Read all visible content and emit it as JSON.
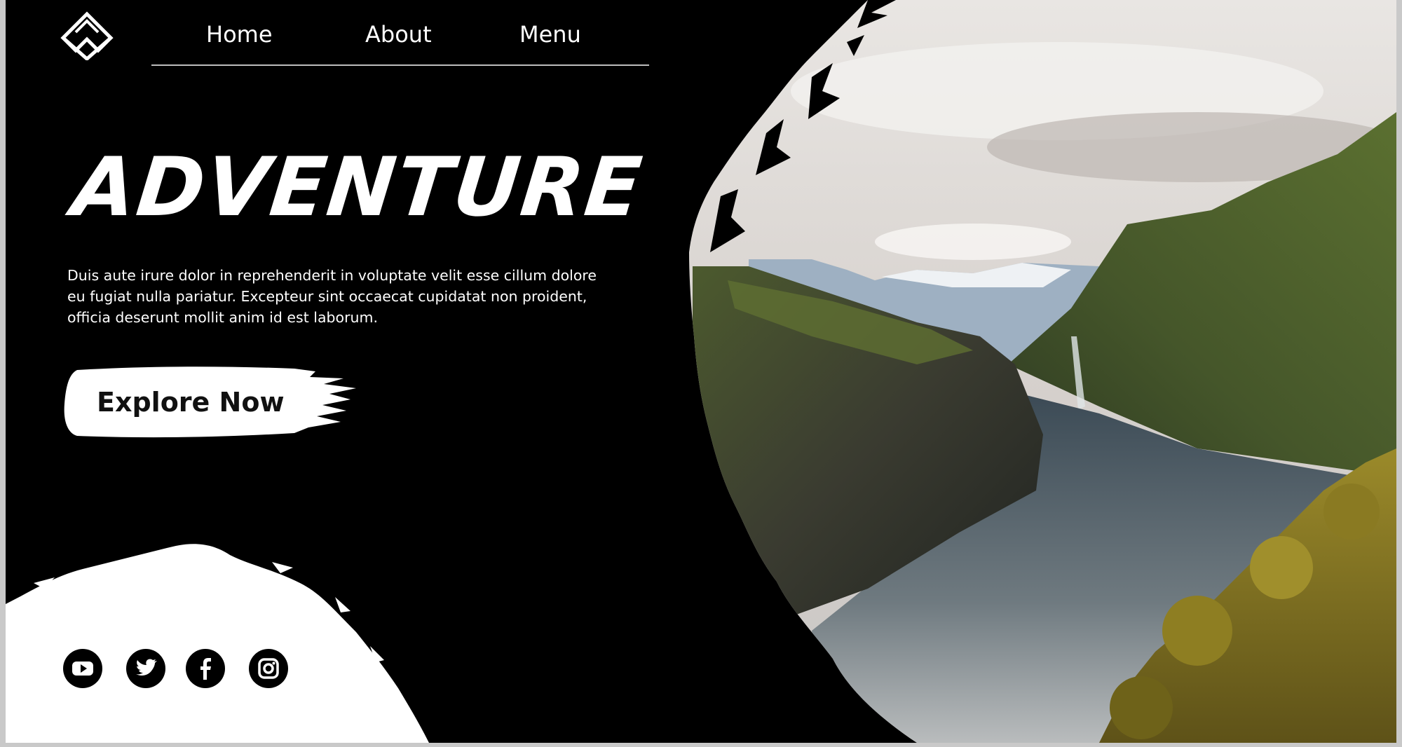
{
  "brand": {
    "logo_icon": "mountain-logo-icon"
  },
  "nav": {
    "items": [
      {
        "label": "Home"
      },
      {
        "label": "About"
      },
      {
        "label": "Menu"
      }
    ]
  },
  "hero": {
    "title": "ADVENTURE",
    "description": "Duis aute irure dolor in reprehenderit in voluptate velit esse cillum dolore eu fugiat nulla pariatur. Excepteur sint occaecat cupidatat non proident, officia deserunt mollit anim id est laborum.",
    "cta_label": "Explore Now"
  },
  "social": [
    {
      "icon": "youtube-icon"
    },
    {
      "icon": "twitter-icon"
    },
    {
      "icon": "facebook-icon"
    },
    {
      "icon": "instagram-icon"
    }
  ],
  "colors": {
    "background": "#000000",
    "text": "#ffffff",
    "button": "#ffffff",
    "button_text": "#111111"
  }
}
